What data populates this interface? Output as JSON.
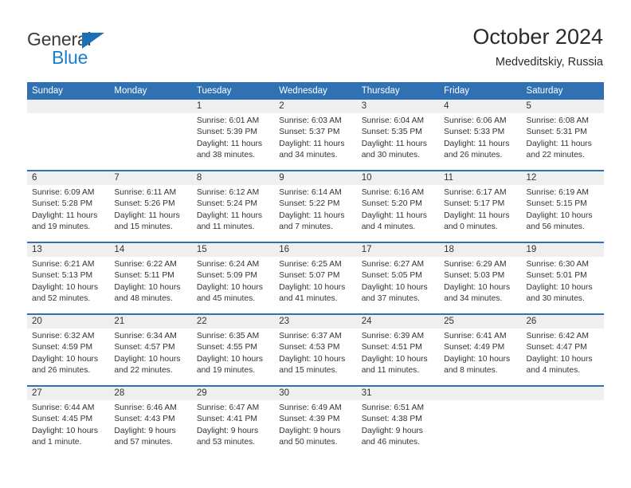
{
  "brand": {
    "name_top": "General",
    "name_bottom": "Blue",
    "triangle_icon": "triangle-icon"
  },
  "header": {
    "title": "October 2024",
    "subtitle": "Medveditskiy, Russia"
  },
  "colors": {
    "header_blue": "#3071b4",
    "daynum_band": "#efefef",
    "brand_blue": "#1a7ec9",
    "text": "#333333"
  },
  "calendar": {
    "weekday_headers": [
      "Sunday",
      "Monday",
      "Tuesday",
      "Wednesday",
      "Thursday",
      "Friday",
      "Saturday"
    ],
    "weeks": [
      [
        {
          "day": "",
          "lines": []
        },
        {
          "day": "",
          "lines": []
        },
        {
          "day": "1",
          "lines": [
            "Sunrise: 6:01 AM",
            "Sunset: 5:39 PM",
            "Daylight: 11 hours",
            "and 38 minutes."
          ]
        },
        {
          "day": "2",
          "lines": [
            "Sunrise: 6:03 AM",
            "Sunset: 5:37 PM",
            "Daylight: 11 hours",
            "and 34 minutes."
          ]
        },
        {
          "day": "3",
          "lines": [
            "Sunrise: 6:04 AM",
            "Sunset: 5:35 PM",
            "Daylight: 11 hours",
            "and 30 minutes."
          ]
        },
        {
          "day": "4",
          "lines": [
            "Sunrise: 6:06 AM",
            "Sunset: 5:33 PM",
            "Daylight: 11 hours",
            "and 26 minutes."
          ]
        },
        {
          "day": "5",
          "lines": [
            "Sunrise: 6:08 AM",
            "Sunset: 5:31 PM",
            "Daylight: 11 hours",
            "and 22 minutes."
          ]
        }
      ],
      [
        {
          "day": "6",
          "lines": [
            "Sunrise: 6:09 AM",
            "Sunset: 5:28 PM",
            "Daylight: 11 hours",
            "and 19 minutes."
          ]
        },
        {
          "day": "7",
          "lines": [
            "Sunrise: 6:11 AM",
            "Sunset: 5:26 PM",
            "Daylight: 11 hours",
            "and 15 minutes."
          ]
        },
        {
          "day": "8",
          "lines": [
            "Sunrise: 6:12 AM",
            "Sunset: 5:24 PM",
            "Daylight: 11 hours",
            "and 11 minutes."
          ]
        },
        {
          "day": "9",
          "lines": [
            "Sunrise: 6:14 AM",
            "Sunset: 5:22 PM",
            "Daylight: 11 hours",
            "and 7 minutes."
          ]
        },
        {
          "day": "10",
          "lines": [
            "Sunrise: 6:16 AM",
            "Sunset: 5:20 PM",
            "Daylight: 11 hours",
            "and 4 minutes."
          ]
        },
        {
          "day": "11",
          "lines": [
            "Sunrise: 6:17 AM",
            "Sunset: 5:17 PM",
            "Daylight: 11 hours",
            "and 0 minutes."
          ]
        },
        {
          "day": "12",
          "lines": [
            "Sunrise: 6:19 AM",
            "Sunset: 5:15 PM",
            "Daylight: 10 hours",
            "and 56 minutes."
          ]
        }
      ],
      [
        {
          "day": "13",
          "lines": [
            "Sunrise: 6:21 AM",
            "Sunset: 5:13 PM",
            "Daylight: 10 hours",
            "and 52 minutes."
          ]
        },
        {
          "day": "14",
          "lines": [
            "Sunrise: 6:22 AM",
            "Sunset: 5:11 PM",
            "Daylight: 10 hours",
            "and 48 minutes."
          ]
        },
        {
          "day": "15",
          "lines": [
            "Sunrise: 6:24 AM",
            "Sunset: 5:09 PM",
            "Daylight: 10 hours",
            "and 45 minutes."
          ]
        },
        {
          "day": "16",
          "lines": [
            "Sunrise: 6:25 AM",
            "Sunset: 5:07 PM",
            "Daylight: 10 hours",
            "and 41 minutes."
          ]
        },
        {
          "day": "17",
          "lines": [
            "Sunrise: 6:27 AM",
            "Sunset: 5:05 PM",
            "Daylight: 10 hours",
            "and 37 minutes."
          ]
        },
        {
          "day": "18",
          "lines": [
            "Sunrise: 6:29 AM",
            "Sunset: 5:03 PM",
            "Daylight: 10 hours",
            "and 34 minutes."
          ]
        },
        {
          "day": "19",
          "lines": [
            "Sunrise: 6:30 AM",
            "Sunset: 5:01 PM",
            "Daylight: 10 hours",
            "and 30 minutes."
          ]
        }
      ],
      [
        {
          "day": "20",
          "lines": [
            "Sunrise: 6:32 AM",
            "Sunset: 4:59 PM",
            "Daylight: 10 hours",
            "and 26 minutes."
          ]
        },
        {
          "day": "21",
          "lines": [
            "Sunrise: 6:34 AM",
            "Sunset: 4:57 PM",
            "Daylight: 10 hours",
            "and 22 minutes."
          ]
        },
        {
          "day": "22",
          "lines": [
            "Sunrise: 6:35 AM",
            "Sunset: 4:55 PM",
            "Daylight: 10 hours",
            "and 19 minutes."
          ]
        },
        {
          "day": "23",
          "lines": [
            "Sunrise: 6:37 AM",
            "Sunset: 4:53 PM",
            "Daylight: 10 hours",
            "and 15 minutes."
          ]
        },
        {
          "day": "24",
          "lines": [
            "Sunrise: 6:39 AM",
            "Sunset: 4:51 PM",
            "Daylight: 10 hours",
            "and 11 minutes."
          ]
        },
        {
          "day": "25",
          "lines": [
            "Sunrise: 6:41 AM",
            "Sunset: 4:49 PM",
            "Daylight: 10 hours",
            "and 8 minutes."
          ]
        },
        {
          "day": "26",
          "lines": [
            "Sunrise: 6:42 AM",
            "Sunset: 4:47 PM",
            "Daylight: 10 hours",
            "and 4 minutes."
          ]
        }
      ],
      [
        {
          "day": "27",
          "lines": [
            "Sunrise: 6:44 AM",
            "Sunset: 4:45 PM",
            "Daylight: 10 hours",
            "and 1 minute."
          ]
        },
        {
          "day": "28",
          "lines": [
            "Sunrise: 6:46 AM",
            "Sunset: 4:43 PM",
            "Daylight: 9 hours",
            "and 57 minutes."
          ]
        },
        {
          "day": "29",
          "lines": [
            "Sunrise: 6:47 AM",
            "Sunset: 4:41 PM",
            "Daylight: 9 hours",
            "and 53 minutes."
          ]
        },
        {
          "day": "30",
          "lines": [
            "Sunrise: 6:49 AM",
            "Sunset: 4:39 PM",
            "Daylight: 9 hours",
            "and 50 minutes."
          ]
        },
        {
          "day": "31",
          "lines": [
            "Sunrise: 6:51 AM",
            "Sunset: 4:38 PM",
            "Daylight: 9 hours",
            "and 46 minutes."
          ]
        },
        {
          "day": "",
          "lines": []
        },
        {
          "day": "",
          "lines": []
        }
      ]
    ]
  }
}
